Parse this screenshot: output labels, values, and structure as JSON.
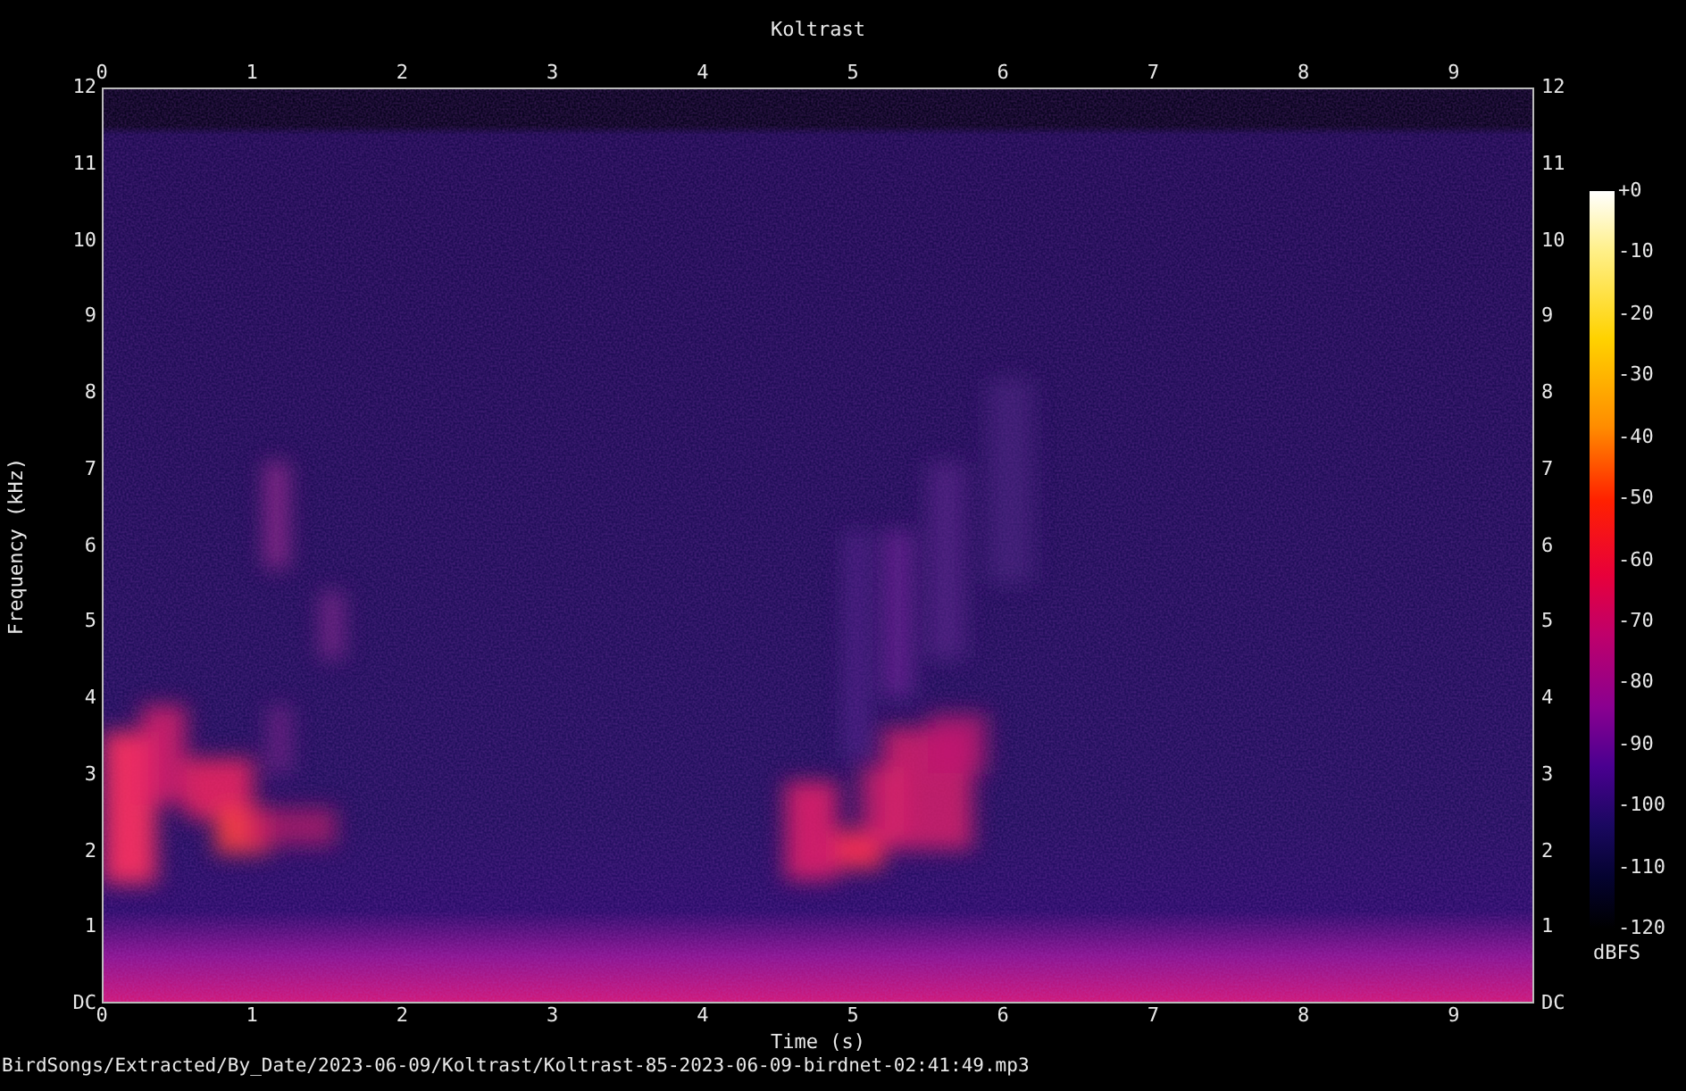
{
  "title": "Koltrast",
  "x_axis_top": {
    "ticks": [
      "0",
      "1",
      "2",
      "3",
      "4",
      "5",
      "6",
      "7",
      "8",
      "9"
    ]
  },
  "y_axis_left": {
    "label": "Frequency (kHz)",
    "ticks": [
      "12",
      "11",
      "10",
      "9",
      "8",
      "7",
      "6",
      "5",
      "4",
      "3",
      "2",
      "1",
      "DC"
    ]
  },
  "y_axis_right": {
    "ticks": [
      "12",
      "11",
      "10",
      "9",
      "8",
      "7",
      "6",
      "5",
      "4",
      "3",
      "2",
      "1",
      "DC"
    ]
  },
  "colorbar": {
    "ticks": [
      "+0",
      "-10",
      "-20",
      "-30",
      "-40",
      "-50",
      "-60",
      "-70",
      "-80",
      "-90",
      "-100",
      "-110",
      "-120"
    ],
    "unit": "dBFS"
  },
  "x_axis_bottom": {
    "ticks": [
      "0",
      "1",
      "2",
      "3",
      "4",
      "5",
      "6",
      "7",
      "8",
      "9"
    ],
    "label": "Time (s)"
  },
  "footer": "BirdSongs/Extracted/By_Date/2023-06-09/Koltrast/Koltrast-85-2023-06-09-birdnet-02:41:49.mp3"
}
